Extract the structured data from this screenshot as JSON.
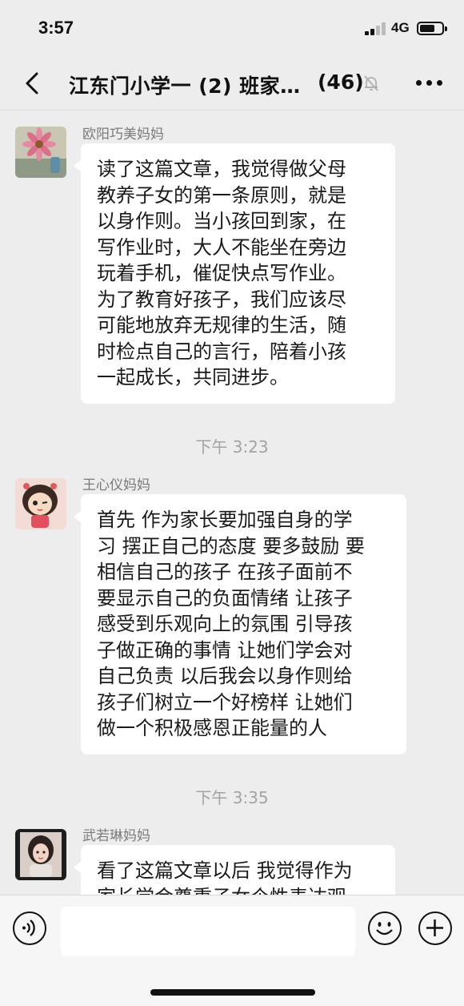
{
  "status_bar": {
    "time": "3:57",
    "network": "4G"
  },
  "header": {
    "title": "江东门小学一 (2) 班家…",
    "member_count": "(46)"
  },
  "messages": [
    {
      "sender": "欧阳巧美妈妈",
      "text": "读了这篇文章，我觉得做父母\n教养子女的第一条原则，就是\n以身作则。当小孩回到家，在\n写作业时，大人不能坐在旁边\n玩着手机，催促快点写作业。\n为了教育好孩子，我们应该尽\n可能地放弃无规律的生活，随\n时检点自己的言行，陪着小孩\n一起成长，共同进步。"
    },
    {
      "sender": "王心仪妈妈",
      "text": "首先 作为家长要加强自身的学\n习 摆正自己的态度 要多鼓励 要\n相信自己的孩子 在孩子面前不\n要显示自己的负面情绪 让孩子\n感受到乐观向上的氛围 引导孩\n子做正确的事情 让她们学会对\n自己负责 以后我会以身作则给\n孩子们树立一个好榜样 让她们\n做一个积极感恩正能量的人"
    },
    {
      "sender": "武若琳妈妈",
      "text": "看了这篇文章以后 我觉得作为\n家长学会尊重子女个性表达观"
    }
  ],
  "timestamps": [
    "下午 3:23",
    "下午 3:35"
  ],
  "input": {
    "value": ""
  },
  "icons": {
    "back": "chevron-left-icon",
    "mute": "bell-slash-icon",
    "more": "more-dots-icon",
    "voice": "voice-icon",
    "emoji": "emoji-icon",
    "plus": "plus-icon"
  },
  "colors": {
    "background": "#ededed",
    "bubble": "#ffffff",
    "sender_text": "#7a7a7a",
    "timestamp_text": "#a3a3a3"
  }
}
